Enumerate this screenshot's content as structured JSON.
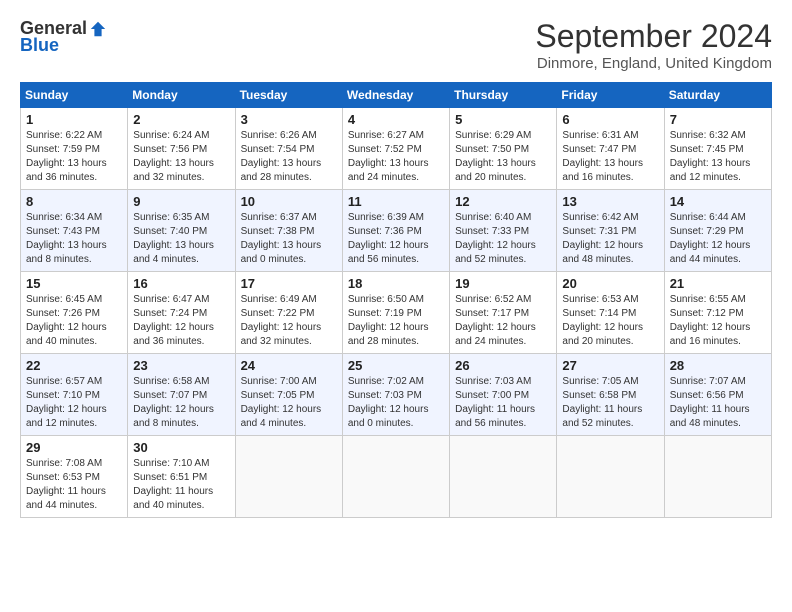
{
  "header": {
    "logo_general": "General",
    "logo_blue": "Blue",
    "title": "September 2024",
    "location": "Dinmore, England, United Kingdom"
  },
  "days_of_week": [
    "Sunday",
    "Monday",
    "Tuesday",
    "Wednesday",
    "Thursday",
    "Friday",
    "Saturday"
  ],
  "weeks": [
    [
      {
        "num": "1",
        "sunrise": "6:22 AM",
        "sunset": "7:59 PM",
        "daylight": "13 hours and 36 minutes."
      },
      {
        "num": "2",
        "sunrise": "6:24 AM",
        "sunset": "7:56 PM",
        "daylight": "13 hours and 32 minutes."
      },
      {
        "num": "3",
        "sunrise": "6:26 AM",
        "sunset": "7:54 PM",
        "daylight": "13 hours and 28 minutes."
      },
      {
        "num": "4",
        "sunrise": "6:27 AM",
        "sunset": "7:52 PM",
        "daylight": "13 hours and 24 minutes."
      },
      {
        "num": "5",
        "sunrise": "6:29 AM",
        "sunset": "7:50 PM",
        "daylight": "13 hours and 20 minutes."
      },
      {
        "num": "6",
        "sunrise": "6:31 AM",
        "sunset": "7:47 PM",
        "daylight": "13 hours and 16 minutes."
      },
      {
        "num": "7",
        "sunrise": "6:32 AM",
        "sunset": "7:45 PM",
        "daylight": "13 hours and 12 minutes."
      }
    ],
    [
      {
        "num": "8",
        "sunrise": "6:34 AM",
        "sunset": "7:43 PM",
        "daylight": "13 hours and 8 minutes."
      },
      {
        "num": "9",
        "sunrise": "6:35 AM",
        "sunset": "7:40 PM",
        "daylight": "13 hours and 4 minutes."
      },
      {
        "num": "10",
        "sunrise": "6:37 AM",
        "sunset": "7:38 PM",
        "daylight": "13 hours and 0 minutes."
      },
      {
        "num": "11",
        "sunrise": "6:39 AM",
        "sunset": "7:36 PM",
        "daylight": "12 hours and 56 minutes."
      },
      {
        "num": "12",
        "sunrise": "6:40 AM",
        "sunset": "7:33 PM",
        "daylight": "12 hours and 52 minutes."
      },
      {
        "num": "13",
        "sunrise": "6:42 AM",
        "sunset": "7:31 PM",
        "daylight": "12 hours and 48 minutes."
      },
      {
        "num": "14",
        "sunrise": "6:44 AM",
        "sunset": "7:29 PM",
        "daylight": "12 hours and 44 minutes."
      }
    ],
    [
      {
        "num": "15",
        "sunrise": "6:45 AM",
        "sunset": "7:26 PM",
        "daylight": "12 hours and 40 minutes."
      },
      {
        "num": "16",
        "sunrise": "6:47 AM",
        "sunset": "7:24 PM",
        "daylight": "12 hours and 36 minutes."
      },
      {
        "num": "17",
        "sunrise": "6:49 AM",
        "sunset": "7:22 PM",
        "daylight": "12 hours and 32 minutes."
      },
      {
        "num": "18",
        "sunrise": "6:50 AM",
        "sunset": "7:19 PM",
        "daylight": "12 hours and 28 minutes."
      },
      {
        "num": "19",
        "sunrise": "6:52 AM",
        "sunset": "7:17 PM",
        "daylight": "12 hours and 24 minutes."
      },
      {
        "num": "20",
        "sunrise": "6:53 AM",
        "sunset": "7:14 PM",
        "daylight": "12 hours and 20 minutes."
      },
      {
        "num": "21",
        "sunrise": "6:55 AM",
        "sunset": "7:12 PM",
        "daylight": "12 hours and 16 minutes."
      }
    ],
    [
      {
        "num": "22",
        "sunrise": "6:57 AM",
        "sunset": "7:10 PM",
        "daylight": "12 hours and 12 minutes."
      },
      {
        "num": "23",
        "sunrise": "6:58 AM",
        "sunset": "7:07 PM",
        "daylight": "12 hours and 8 minutes."
      },
      {
        "num": "24",
        "sunrise": "7:00 AM",
        "sunset": "7:05 PM",
        "daylight": "12 hours and 4 minutes."
      },
      {
        "num": "25",
        "sunrise": "7:02 AM",
        "sunset": "7:03 PM",
        "daylight": "12 hours and 0 minutes."
      },
      {
        "num": "26",
        "sunrise": "7:03 AM",
        "sunset": "7:00 PM",
        "daylight": "11 hours and 56 minutes."
      },
      {
        "num": "27",
        "sunrise": "7:05 AM",
        "sunset": "6:58 PM",
        "daylight": "11 hours and 52 minutes."
      },
      {
        "num": "28",
        "sunrise": "7:07 AM",
        "sunset": "6:56 PM",
        "daylight": "11 hours and 48 minutes."
      }
    ],
    [
      {
        "num": "29",
        "sunrise": "7:08 AM",
        "sunset": "6:53 PM",
        "daylight": "11 hours and 44 minutes."
      },
      {
        "num": "30",
        "sunrise": "7:10 AM",
        "sunset": "6:51 PM",
        "daylight": "11 hours and 40 minutes."
      },
      null,
      null,
      null,
      null,
      null
    ]
  ]
}
